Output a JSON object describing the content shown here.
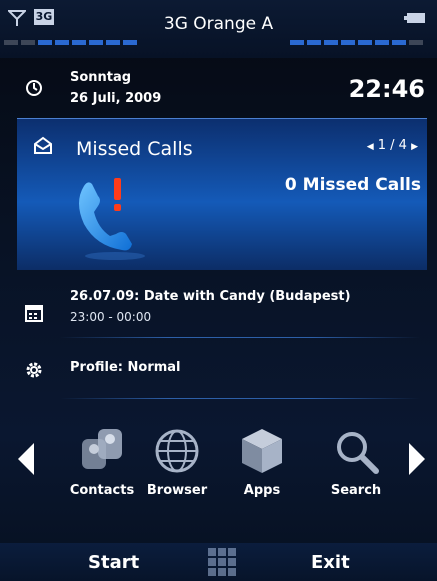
{
  "status_bar": {
    "network_badge": "3G",
    "operator": "3G Orange A",
    "icons": [
      "signal-icon",
      "battery-icon"
    ]
  },
  "clock": {
    "day": "Sonntag",
    "date": "26 Juli, 2009",
    "time": "22:46",
    "icon": "clock-icon"
  },
  "missed_calls": {
    "title": "Missed Calls",
    "pager": "1 / 4",
    "count_text": "0 Missed Calls",
    "icon": "envelope-icon"
  },
  "appointment": {
    "title": "26.07.09: Date with Candy (Budapest)",
    "time": "23:00 - 00:00",
    "icon": "calendar-icon"
  },
  "profile": {
    "label": "Profile: Normal",
    "icon": "gear-icon"
  },
  "launcher": {
    "apps": [
      {
        "label": "Contacts",
        "icon": "contacts-icon"
      },
      {
        "label": "Browser",
        "icon": "globe-icon"
      },
      {
        "label": "Apps",
        "icon": "cube-icon"
      },
      {
        "label": "Search",
        "icon": "magnifier-icon"
      }
    ]
  },
  "softkeys": {
    "left": "Start",
    "right": "Exit"
  },
  "colors": {
    "accent": "#145ab8",
    "bar_blue": "#2a69d1"
  }
}
